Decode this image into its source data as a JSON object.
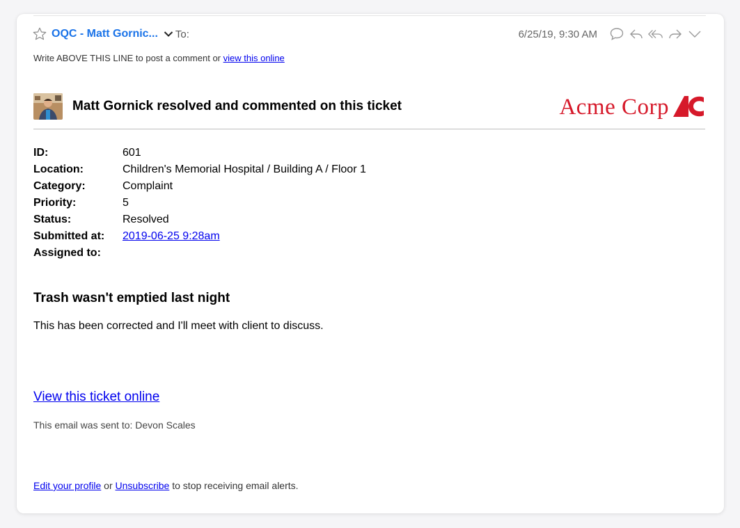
{
  "mail": {
    "sender": "OQC - Matt Gornic...",
    "to_label": "To:",
    "date": "6/25/19, 9:30 AM",
    "icons": [
      "star-icon",
      "chevron-down-icon",
      "comment-bubble-icon",
      "reply-icon",
      "reply-all-icon",
      "forward-icon",
      "more-chevron-icon"
    ]
  },
  "above_line": {
    "text": "Write ABOVE THIS LINE to post a comment or ",
    "link": "view this online"
  },
  "notification": {
    "title": "Matt Gornick resolved and commented on this ticket",
    "logo_text": "Acme Corp",
    "logo_color": "#d6192a"
  },
  "details": [
    {
      "label": "ID:",
      "value": "601"
    },
    {
      "label": "Location:",
      "value": "Children's Memorial Hospital / Building A / Floor 1"
    },
    {
      "label": "Category:",
      "value": "Complaint"
    },
    {
      "label": "Priority:",
      "value": "5"
    },
    {
      "label": "Status:",
      "value": "Resolved"
    },
    {
      "label": "Submitted at:",
      "value": "2019-06-25 9:28am",
      "is_link": true
    },
    {
      "label": "Assigned to:",
      "value": ""
    }
  ],
  "ticket": {
    "subject": "Trash wasn't emptied last night",
    "comment": "This has been corrected and I'll meet with client to discuss."
  },
  "view_ticket_link": "View this ticket online",
  "sent_to": "This email was sent to: Devon Scales",
  "footer": {
    "edit_link": "Edit your profile",
    "or": " or ",
    "unsubscribe_link": "Unsubscribe",
    "rest": " to stop receiving email alerts."
  }
}
